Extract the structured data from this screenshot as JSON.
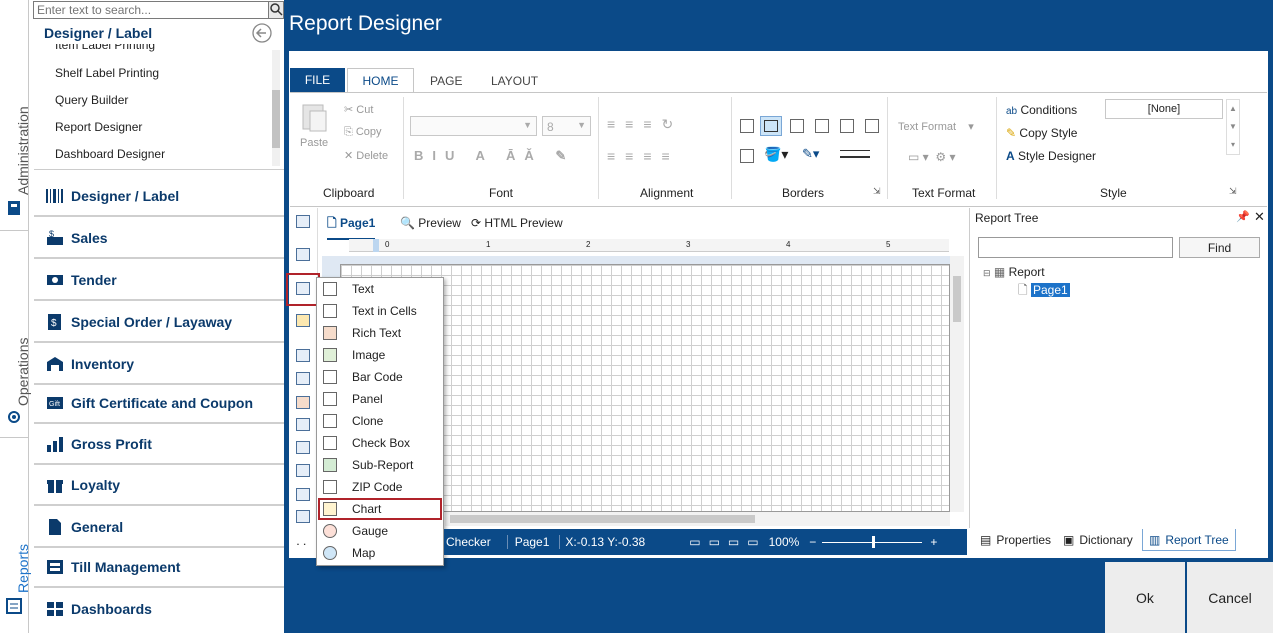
{
  "sidebar_tabs": {
    "administration": "Administration",
    "operations": "Operations",
    "reports": "Reports"
  },
  "search": {
    "placeholder": "Enter text to search..."
  },
  "submenu": {
    "title": "Designer / Label",
    "partial_item": "Item Label Printing",
    "items": [
      "Shelf Label Printing",
      "Query Builder",
      "Report Designer",
      "Dashboard Designer"
    ]
  },
  "nav": [
    {
      "label": "Designer / Label",
      "icon": "barcode-icon"
    },
    {
      "label": "Sales",
      "icon": "cash-register-icon"
    },
    {
      "label": "Tender",
      "icon": "banknote-icon"
    },
    {
      "label": "Special Order / Layaway",
      "icon": "special-order-icon"
    },
    {
      "label": "Inventory",
      "icon": "warehouse-icon"
    },
    {
      "label": "Gift Certificate and Coupon",
      "icon": "gift-card-icon"
    },
    {
      "label": "Gross Profit",
      "icon": "bar-chart-icon"
    },
    {
      "label": "Loyalty",
      "icon": "gift-icon"
    },
    {
      "label": "General",
      "icon": "document-icon"
    },
    {
      "label": "Till Management",
      "icon": "cash-drawer-icon"
    },
    {
      "label": "Dashboards",
      "icon": "dashboard-icon"
    }
  ],
  "header": {
    "title": "Report Designer"
  },
  "ribbon": {
    "tabs": [
      "FILE",
      "HOME",
      "PAGE",
      "LAYOUT"
    ],
    "active_tab": "HOME",
    "clipboard": {
      "paste": "Paste",
      "cut": "Cut",
      "copy": "Copy",
      "delete": "Delete",
      "group": "Clipboard"
    },
    "font": {
      "size": "8",
      "group": "Font"
    },
    "alignment": {
      "group": "Alignment"
    },
    "borders": {
      "group": "Borders"
    },
    "textformat": {
      "label": "Text Format",
      "group": "Text Format"
    },
    "style": {
      "conditions": "Conditions",
      "copy_style": "Copy Style",
      "style_designer": "Style Designer",
      "style_value": "[None]",
      "group": "Style"
    }
  },
  "doc_tabs": {
    "page": "Page1",
    "preview": "Preview",
    "html_preview": "HTML Preview"
  },
  "ruler": [
    "0",
    "1",
    "2",
    "3",
    "4",
    "5"
  ],
  "dropdown": {
    "items": [
      "Text",
      "Text in Cells",
      "Rich Text",
      "Image",
      "Bar Code",
      "Panel",
      "Clone",
      "Check Box",
      "Sub-Report",
      "ZIP Code",
      "Chart",
      "Gauge",
      "Map"
    ],
    "highlighted": "Chart"
  },
  "report_tree": {
    "title": "Report Tree",
    "find": "Find",
    "root": "Report",
    "child": "Page1"
  },
  "status": {
    "checker": "Checker",
    "page": "Page1",
    "coords": "X:-0.13  Y:-0.38",
    "zoom": "100%"
  },
  "bottom_tabs": {
    "properties": "Properties",
    "dictionary": "Dictionary",
    "report_tree": "Report Tree"
  },
  "buttons": {
    "ok": "Ok",
    "cancel": "Cancel"
  },
  "colors": {
    "brand": "#0b4a88",
    "highlight": "#b0232a"
  }
}
